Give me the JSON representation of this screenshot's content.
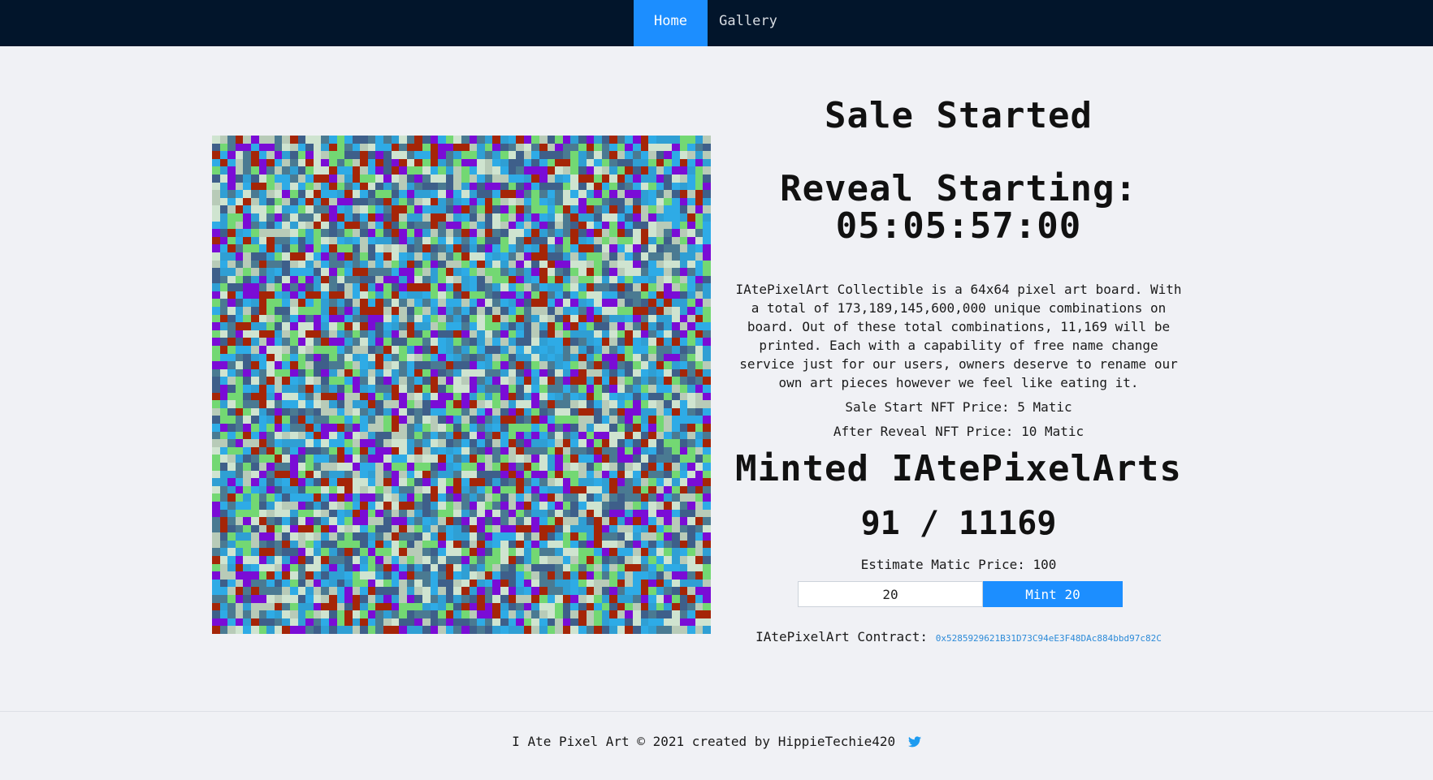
{
  "nav": {
    "items": [
      {
        "label": "Home",
        "active": true
      },
      {
        "label": "Gallery",
        "active": false
      }
    ]
  },
  "board": {
    "grid_size": 64,
    "palette": [
      "#2eabe6",
      "#4a7a92",
      "#73d873",
      "#7a0cd6",
      "#a52507",
      "#b8cbb8",
      "#3e5f8a",
      "#cfe4d0",
      "#2f9fd4"
    ]
  },
  "info": {
    "title": "Sale Started",
    "reveal_label": "Reveal Starting:",
    "countdown": "05:05:57:00",
    "description": "IAtePixelArt Collectible is a 64x64 pixel art board. With a total of 173,189,145,600,000 unique combinations on board. Out of these total combinations, 11,169 will be printed. Each with a capability of free name change service just for our users, owners deserve to rename our own art pieces however we feel like eating it.",
    "sale_start_price": "Sale Start NFT Price: 5 Matic",
    "after_reveal_price": "After Reveal NFT Price: 10 Matic",
    "minted_title": "Minted IAtePixelArts",
    "minted_count": "91 / 11169",
    "estimate": "Estimate Matic Price: 100",
    "mint_quantity": "20",
    "mint_button": "Mint 20",
    "contract_label": "IAtePixelArt Contract:",
    "contract_address": "0x5285929621B31D73C94eE3F48DAc884bbd97c82C"
  },
  "footer": {
    "text": "I Ate Pixel Art © 2021 created by HippieTechie420",
    "twitter_icon": "twitter-icon"
  },
  "colors": {
    "navbar": "#02152b",
    "accent": "#1c8eff",
    "background": "#f0f1f5",
    "link": "#2d8bd8"
  }
}
